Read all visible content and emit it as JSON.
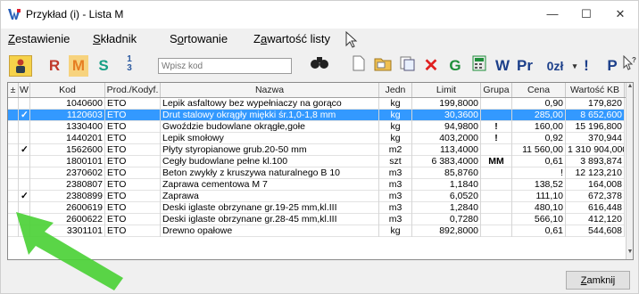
{
  "window": {
    "title": "Przykład (i) - Lista M"
  },
  "menu": {
    "zestawienie_u": "Z",
    "zestawienie_rest": "estawienie",
    "skladnik_u": "S",
    "skladnik_rest": "kładnik",
    "sortowanie_a": "S",
    "sortowanie_u": "o",
    "sortowanie_rest": "rtowanie",
    "zawartosc_a": "Z",
    "zawartosc_u": "a",
    "zawartosc_rest": "wartość listy"
  },
  "toolbar": {
    "r": "R",
    "m": "M",
    "s": "S",
    "g": "G",
    "w": "W",
    "pr": "Pr",
    "zl": "0zł",
    "excl": "!",
    "p": "P"
  },
  "search": {
    "placeholder": "Wpisz kod"
  },
  "columns": [
    "±",
    "W",
    "Kod",
    "Prod./Kodyf.",
    "Nazwa",
    "Jedn",
    "Limit",
    "Grupa",
    "Cena",
    "Wartość KB"
  ],
  "rows": [
    {
      "w": "",
      "kod": "1040600",
      "prod": "ETO",
      "nazwa": "Lepik asfaltowy bez wypełniaczy na gorąco",
      "jedn": "kg",
      "limit": "199,8000",
      "grupa": "",
      "cena": "0,90",
      "wartosc": "179,820"
    },
    {
      "w": "✓",
      "kod": "1120603",
      "prod": "ETO",
      "nazwa": "Drut stalowy okrągły miękki śr.1,0-1,8 mm",
      "jedn": "kg",
      "limit": "30,3600",
      "grupa": "",
      "cena": "285,00",
      "wartosc": "8 652,600"
    },
    {
      "w": "",
      "kod": "1330400",
      "prod": "ETO",
      "nazwa": "Gwoździe budowlane okrągłe,gołe",
      "jedn": "kg",
      "limit": "94,9800",
      "grupa": "!",
      "cena": "160,00",
      "wartosc": "15 196,800"
    },
    {
      "w": "",
      "kod": "1440201",
      "prod": "ETO",
      "nazwa": "Lepik smołowy",
      "jedn": "kg",
      "limit": "403,2000",
      "grupa": "!",
      "cena": "0,92",
      "wartosc": "370,944"
    },
    {
      "w": "✓",
      "kod": "1562600",
      "prod": "ETO",
      "nazwa": "Płyty styropianowe grub.20-50 mm",
      "jedn": "m2",
      "limit": "113,4000",
      "grupa": "",
      "cena": "11 560,00",
      "wartosc": "1 310 904,000"
    },
    {
      "w": "",
      "kod": "1800101",
      "prod": "ETO",
      "nazwa": "Cegły budowlane pełne kl.100",
      "jedn": "szt",
      "limit": "6 383,4000",
      "grupa": "MM",
      "cena": "0,61",
      "wartosc": "3 893,874"
    },
    {
      "w": "",
      "kod": "2370602",
      "prod": "ETO",
      "nazwa": "Beton zwykły z kruszywa naturalnego B 10",
      "jedn": "m3",
      "limit": "85,8760",
      "grupa": "",
      "cena": "!",
      "wartosc": "12 123,210"
    },
    {
      "w": "",
      "kod": "2380807",
      "prod": "ETO",
      "nazwa": "Zaprawa cementowa M 7",
      "jedn": "m3",
      "limit": "1,1840",
      "grupa": "",
      "cena": "138,52",
      "wartosc": "164,008"
    },
    {
      "w": "✓",
      "kod": "2380899",
      "prod": "ETO",
      "nazwa": "Zaprawa",
      "jedn": "m3",
      "limit": "6,0520",
      "grupa": "",
      "cena": "111,10",
      "wartosc": "672,378"
    },
    {
      "w": "",
      "kod": "2600619",
      "prod": "ETO",
      "nazwa": "Deski iglaste obrzynane gr.19-25 mm,kl.III",
      "jedn": "m3",
      "limit": "1,2840",
      "grupa": "",
      "cena": "480,10",
      "wartosc": "616,448"
    },
    {
      "w": "",
      "kod": "2600622",
      "prod": "ETO",
      "nazwa": "Deski iglaste obrzynane gr.28-45 mm,kl.III",
      "jedn": "m3",
      "limit": "0,7280",
      "grupa": "",
      "cena": "566,10",
      "wartosc": "412,120"
    },
    {
      "w": "",
      "kod": "3301101",
      "prod": "ETO",
      "nazwa": "Drewno opałowe",
      "jedn": "kg",
      "limit": "892,8000",
      "grupa": "",
      "cena": "0,61",
      "wartosc": "544,608"
    }
  ],
  "footer": {
    "close_u": "Z",
    "close_rest": "amknij"
  },
  "colors": {
    "selection": "#3399ff",
    "arrow": "#4cd137"
  }
}
